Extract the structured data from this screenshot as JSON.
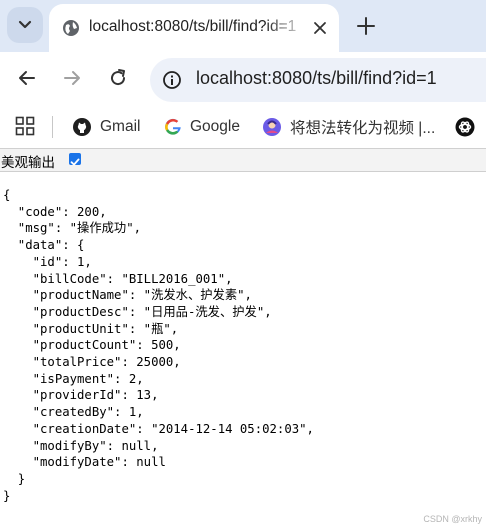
{
  "browser": {
    "tab": {
      "title": "localhost:8080/ts/bill/find?id=1",
      "close_icon": "close-icon",
      "favicon": "globe-icon"
    },
    "new_tab_icon": "plus-icon",
    "tab_menu_icon": "chevron-down-icon",
    "nav": {
      "back_icon": "back-arrow-icon",
      "forward_icon": "forward-arrow-icon",
      "reload_icon": "reload-icon"
    },
    "address": {
      "url": "localhost:8080/ts/bill/find?id=1",
      "info_icon": "info-icon"
    },
    "bookmarks": [
      {
        "label": "",
        "icon": "apps-grid-icon"
      },
      {
        "label": "Gmail",
        "icon": "github-icon"
      },
      {
        "label": "Google",
        "icon": "google-icon"
      },
      {
        "label": "将想法转化为视频 |...",
        "icon": "ai-avatar-icon"
      },
      {
        "label": "",
        "icon": "openai-icon"
      }
    ]
  },
  "content": {
    "pretty_print_label": "美观输出",
    "pretty_print_checked": true,
    "json_lines": [
      "{",
      "  \"code\": 200,",
      "  \"msg\": \"操作成功\",",
      "  \"data\": {",
      "    \"id\": 1,",
      "    \"billCode\": \"BILL2016_001\",",
      "    \"productName\": \"洗发水、护发素\",",
      "    \"productDesc\": \"日用品-洗发、护发\",",
      "    \"productUnit\": \"瓶\",",
      "    \"productCount\": 500,",
      "    \"totalPrice\": 25000,",
      "    \"isPayment\": 2,",
      "    \"providerId\": 13,",
      "    \"createdBy\": 1,",
      "    \"creationDate\": \"2014-12-14 05:02:03\",",
      "    \"modifyBy\": null,",
      "    \"modifyDate\": null",
      "  }",
      "}"
    ]
  },
  "watermark": "CSDN @xrkhy",
  "colors": {
    "tabstrip": "#dfe8f6",
    "omnibox": "#edf1f9",
    "checkbox": "#1a73e8"
  }
}
